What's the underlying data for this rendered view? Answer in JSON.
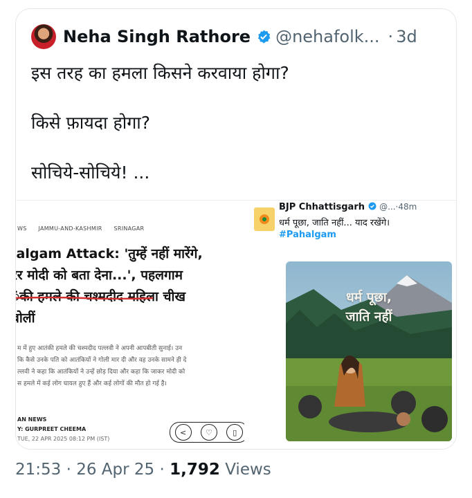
{
  "tweet": {
    "author_name": "Neha Singh Rathore",
    "handle": "@nehafolk...",
    "separator": "·",
    "age": "3d",
    "lines": [
      "इस तरह का हमला किसने करवाया होगा?",
      "किसे फ़ायदा होगा?",
      "सोचिये-सोचिये! ..."
    ]
  },
  "article": {
    "crumbs": [
      "WS",
      "JAMMU-AND-KASHMIR",
      "SRINAGAR"
    ],
    "headline_lines": [
      "ıalgam Attack: 'तुम्हें नहीं मारेंगे,",
      "रर मोदी को बता देना...', पहलगाम",
      "ंकी हमले की चश्मदीद महिला चीख",
      "बोलीं"
    ],
    "body_lines": [
      "म में हुए आतंकी हमले की चश्मदीद पल्लवी ने अपनी आपबीती सुनाई। उन",
      "कि कैसे उनके पति को आतंकियों ने गोली मार दी और वह उनके सामने ही दे",
      "ल्लवी ने कहा कि आतंकियों ने उन्हें छोड़ दिया और कहा कि जाकर मोदी को",
      "स हमले में कई लोग घायल हुए हैं और कई लोगों की मौत हो गई है।"
    ],
    "source": "AN NEWS",
    "author": "Y: GURPREET CHEEMA",
    "date": "TUE, 22 APR 2025 08:12 PM (IST)"
  },
  "embed": {
    "name": "BJP Chhattisgarh",
    "handle_time": "@...·48m",
    "text": "धर्म पूछा, जाति नहीं... याद रखेंगे।",
    "hashtag": "#Pahalgam",
    "art_line1": "धर्म पूछा,",
    "art_line2": "जाति नहीं"
  },
  "footer": {
    "time": "21:53",
    "sep1": "·",
    "date": "26 Apr 25",
    "sep2": "·",
    "views_count": "1,792",
    "views_label": "Views"
  },
  "colors": {
    "verified": "#1d9bf0",
    "link": "#1d9bf0",
    "muted": "#536471",
    "underline": "#d32f2f"
  },
  "icons": [
    "verified-badge-icon",
    "share-icon",
    "heart-icon",
    "bookmark-icon"
  ]
}
